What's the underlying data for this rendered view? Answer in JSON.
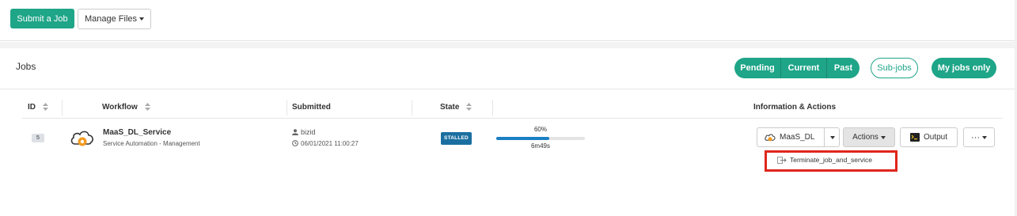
{
  "toolbar": {
    "submit_label": "Submit a Job",
    "manage_label": "Manage Files"
  },
  "jobs": {
    "title": "Jobs",
    "filters": {
      "pending": "Pending",
      "current": "Current",
      "past": "Past"
    },
    "subjobs_label": "Sub-jobs",
    "myjobs_label": "My jobs only"
  },
  "table": {
    "headers": {
      "id": "ID",
      "workflow": "Workflow",
      "submitted": "Submitted",
      "state": "State",
      "info": "Information & Actions"
    },
    "rows": [
      {
        "id": "5",
        "workflow_name": "MaaS_DL_Service",
        "workflow_bucket": "Service Automation - Management",
        "user": "bizid",
        "date": "06/01/2021 11:00:27",
        "state": "STALLED",
        "progress_label": "60%",
        "progress": 0.6,
        "duration": "6m49s"
      }
    ]
  },
  "actions": {
    "maas_label": "MaaS_DL",
    "actions_label": "Actions",
    "output_label": "Output",
    "more_label": "···",
    "dropdown_item": "Terminate_job_and_service"
  },
  "colors": {
    "primary": "#1fa588",
    "state_badge": "#1a6fa0",
    "progress": "#1a7fc4",
    "highlight": "#e0261b"
  }
}
